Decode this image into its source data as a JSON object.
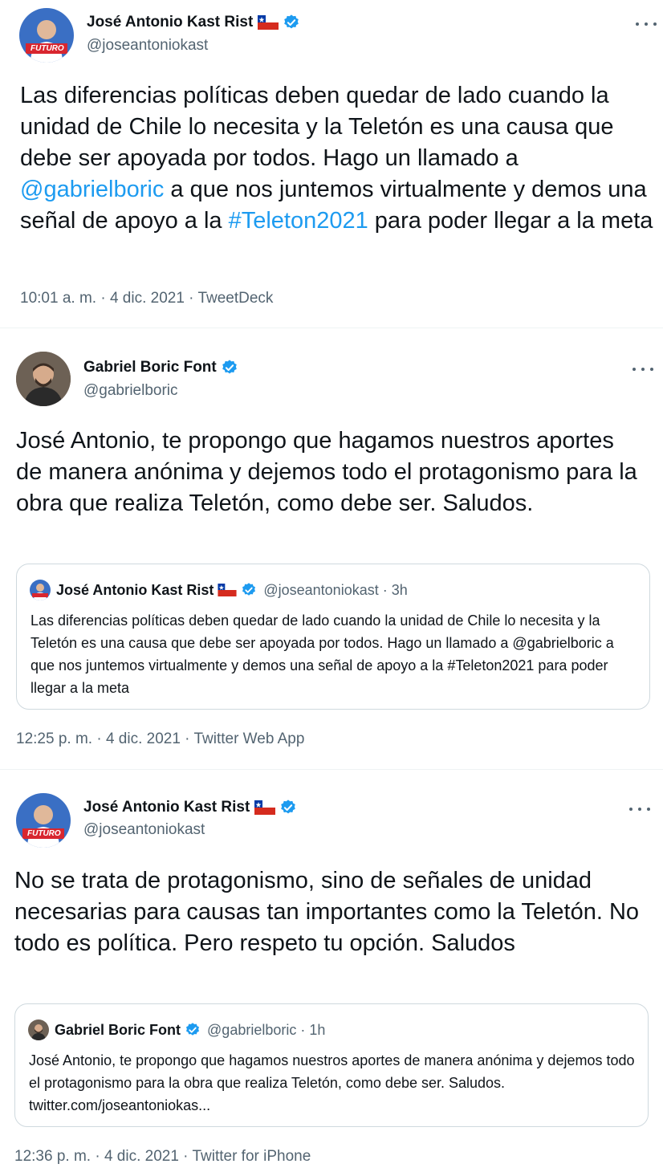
{
  "tweets": [
    {
      "name": "José Antonio Kast Rist",
      "handle": "@joseantoniokast",
      "text_parts": [
        "Las diferencias políticas deben quedar de lado cuando la unidad de Chile lo necesita y la Teletón es una causa que debe ser apoyada por todos. Hago un llamado a ",
        "@gabrielboric",
        " a que nos juntemos virtualmente y demos una señal de apoyo a la ",
        "#Teleton2021",
        " para poder llegar a la meta"
      ],
      "avatar_badge": "FUTURO",
      "meta": "10:01 a. m. · 4 dic. 2021 · TweetDeck"
    },
    {
      "name": "Gabriel Boric Font",
      "handle": "@gabrielboric",
      "text": "José Antonio, te propongo que hagamos nuestros aportes de manera anónima y dejemos todo el protagonismo para la obra que realiza Teletón, como debe ser. Saludos.",
      "quote": {
        "name": "José Antonio Kast Rist",
        "handle_time": "@joseantoniokast · 3h",
        "text": "Las diferencias políticas deben quedar de lado cuando la unidad de Chile lo necesita y la Teletón es una causa que debe ser apoyada por todos. Hago un llamado a @gabrielboric a que nos juntemos virtualmente y demos una señal de apoyo a la #Teleton2021 para poder llegar a la meta"
      },
      "meta": "12:25 p. m. · 4 dic. 2021 · Twitter Web App"
    },
    {
      "name": "José Antonio Kast Rist",
      "handle": "@joseantoniokast",
      "text": "No se trata de protagonismo, sino de señales de unidad necesarias para causas tan importantes como la Teletón. No todo es política. Pero respeto tu opción. Saludos",
      "avatar_badge": "FUTURO",
      "quote": {
        "name": "Gabriel Boric Font",
        "handle_time": "@gabrielboric · 1h",
        "text": "José Antonio, te propongo que hagamos nuestros aportes de manera anónima y dejemos todo el protagonismo para la obra que realiza Teletón, como debe ser. Saludos. twitter.com/joseantoniokas..."
      },
      "meta": "12:36 p. m. · 4 dic. 2021 · Twitter for iPhone"
    }
  ],
  "icons": {
    "verified": "verified-badge-icon",
    "flag": "chile-flag-icon",
    "more": "more-options-icon"
  },
  "colors": {
    "link": "#1d9bf0",
    "text": "#0f1419",
    "secondary": "#536471",
    "border": "#cfd9de"
  }
}
